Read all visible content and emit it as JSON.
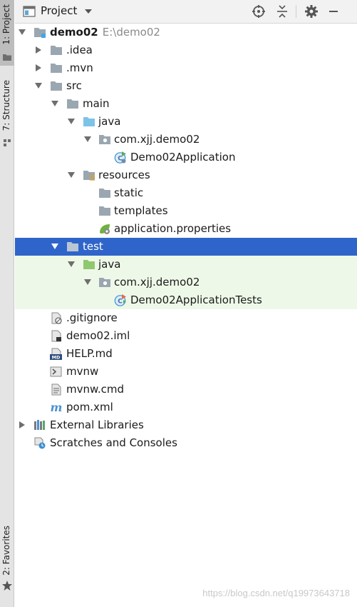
{
  "left_strip": {
    "project_tab": "1: Project",
    "structure_tab": "7: Structure",
    "favorites_tab": "2: Favorites"
  },
  "header": {
    "title": "Project",
    "icons": [
      "project-view-icon",
      "dropdown-arrow-icon",
      "locate-target-icon",
      "collapse-all-icon",
      "gear-icon",
      "minimize-icon"
    ]
  },
  "tree": [
    {
      "label": "demo02",
      "path": "E:\\demo02",
      "icon": "module-folder-icon",
      "arrow": "expanded"
    },
    {
      "label": ".idea",
      "icon": "folder-icon",
      "arrow": "collapsed"
    },
    {
      "label": ".mvn",
      "icon": "folder-icon",
      "arrow": "collapsed"
    },
    {
      "label": "src",
      "icon": "folder-icon",
      "arrow": "expanded"
    },
    {
      "label": "main",
      "icon": "folder-icon",
      "arrow": "expanded"
    },
    {
      "label": "java",
      "icon": "source-root-folder-icon",
      "arrow": "expanded"
    },
    {
      "label": "com.xjj.demo02",
      "icon": "package-icon",
      "arrow": "expanded"
    },
    {
      "label": "Demo02Application",
      "icon": "spring-boot-class-icon"
    },
    {
      "label": "resources",
      "icon": "resources-folder-icon",
      "arrow": "expanded"
    },
    {
      "label": "static",
      "icon": "folder-icon"
    },
    {
      "label": "templates",
      "icon": "folder-icon"
    },
    {
      "label": "application.properties",
      "icon": "spring-properties-icon"
    },
    {
      "label": "test",
      "icon": "folder-icon",
      "arrow": "expanded",
      "state": "selected"
    },
    {
      "label": "java",
      "icon": "test-root-folder-icon",
      "arrow": "expanded",
      "state": "test"
    },
    {
      "label": "com.xjj.demo02",
      "icon": "package-icon",
      "arrow": "expanded",
      "state": "test"
    },
    {
      "label": "Demo02ApplicationTests",
      "icon": "test-class-icon",
      "state": "test"
    },
    {
      "label": ".gitignore",
      "icon": "ignored-file-icon"
    },
    {
      "label": "demo02.iml",
      "icon": "iml-file-icon"
    },
    {
      "label": "HELP.md",
      "icon": "markdown-file-icon"
    },
    {
      "label": "mvnw",
      "icon": "shell-script-icon"
    },
    {
      "label": "mvnw.cmd",
      "icon": "text-file-icon"
    },
    {
      "label": "pom.xml",
      "icon": "maven-icon"
    },
    {
      "label": "External Libraries",
      "icon": "libraries-icon",
      "arrow": "collapsed"
    },
    {
      "label": "Scratches and Consoles",
      "icon": "scratches-icon"
    }
  ],
  "colors": {
    "selection": "#2f65ca",
    "test_scope": "#eef8e8",
    "folder": "#9aa7b0",
    "source_folder": "#7dc3e8",
    "test_folder": "#8fc86f"
  },
  "watermark": "https://blog.csdn.net/q19973643718"
}
